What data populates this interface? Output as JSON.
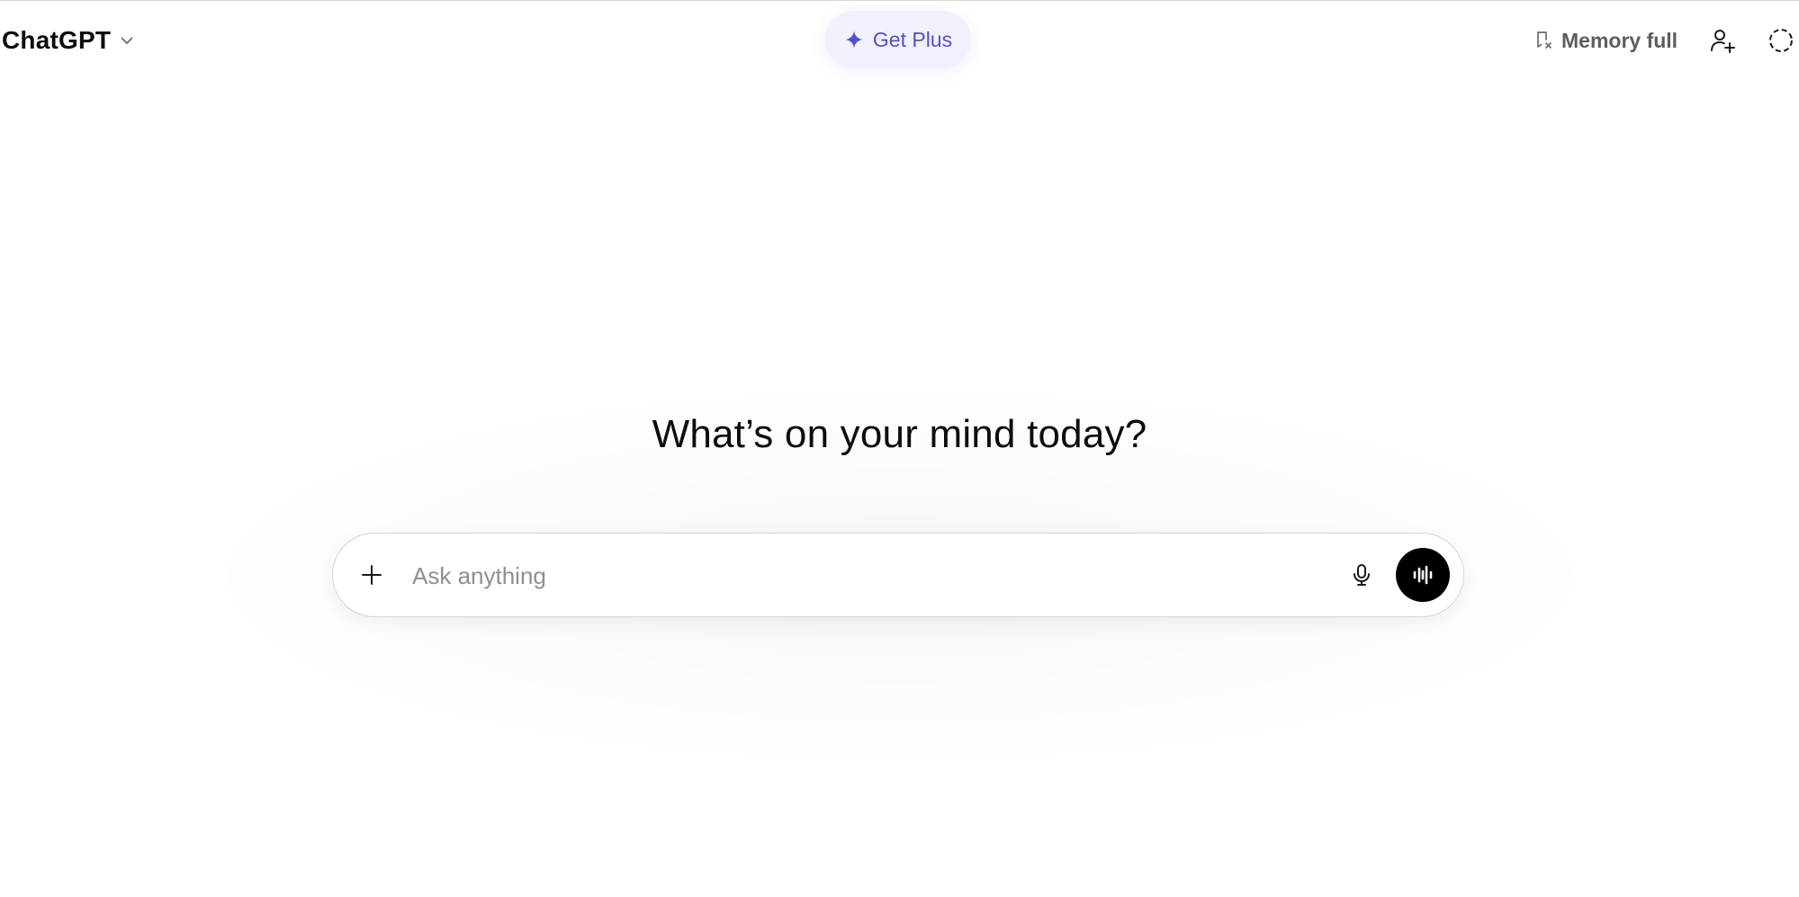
{
  "header": {
    "model_title": "ChatGPT",
    "model_dropdown_icon": "chevron-down-icon",
    "upgrade": {
      "label": "Get Plus",
      "icon": "sparkle-icon",
      "color": "#5450c8"
    },
    "memory": {
      "label": "Memory full",
      "icon": "memory-full-icon"
    },
    "actions": [
      {
        "name": "add-people-icon"
      },
      {
        "name": "temporary-chat-icon"
      }
    ]
  },
  "main": {
    "headline": "What’s on your mind today?",
    "composer": {
      "placeholder": "Ask anything",
      "value": "",
      "attach_icon": "plus-icon",
      "dictate_icon": "microphone-icon",
      "voice_icon": "voice-mode-icon"
    }
  },
  "colors": {
    "accent": "#5450c8",
    "accent_bg": "#f1f0fd",
    "voice_button": "#000000"
  }
}
